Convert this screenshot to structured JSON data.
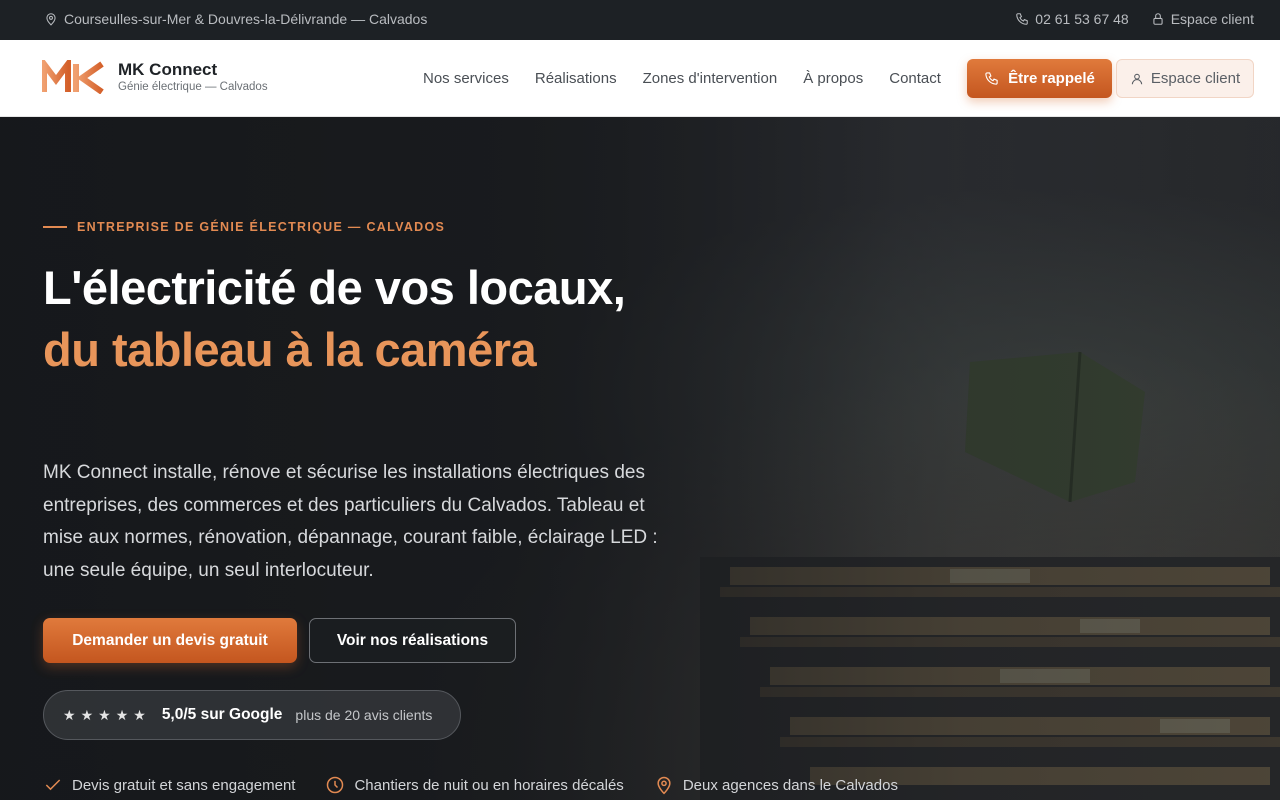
{
  "topbar": {
    "location": "Courseulles-sur-Mer & Douvres-la-Délivrande — Calvados",
    "phone": "02 61 53 67 48",
    "client_space": "Espace client"
  },
  "header": {
    "brand_name": "MK Connect",
    "brand_subtitle": "Génie électrique — Calvados",
    "nav": [
      "Nos services",
      "Réalisations",
      "Zones d'intervention",
      "À propos",
      "Contact"
    ],
    "call_button": "Être rappelé",
    "client_button": "Espace client"
  },
  "hero": {
    "eyebrow": "ENTREPRISE DE GÉNIE ÉLECTRIQUE — CALVADOS",
    "title_white": "L'électricité de vos locaux, ",
    "title_accent": "du tableau à la caméra",
    "lead": "MK Connect installe, rénove et sécurise les installations électriques des entreprises, des commerces et des particuliers du Calvados. Tableau et mise aux normes, rénovation, dépannage, courant faible, éclairage LED : une seule équipe, un seul interlocuteur.",
    "primary_cta": "Demander un devis gratuit",
    "secondary_cta": "Voir nos réalisations",
    "rating": {
      "stars": 5,
      "score": "5,0/5 sur Google",
      "count": "plus de 20 avis clients"
    },
    "features": [
      {
        "icon": "check-icon",
        "label": "Devis gratuit et sans engagement"
      },
      {
        "icon": "clock-icon",
        "label": "Chantiers de nuit ou en horaires décalés"
      },
      {
        "icon": "location-pin-icon",
        "label": "Deux agences dans le Calvados"
      }
    ]
  },
  "colors": {
    "accent": "#e07a3c",
    "topbar_bg": "#1d2125",
    "hero_bg": "#1b1d20"
  }
}
